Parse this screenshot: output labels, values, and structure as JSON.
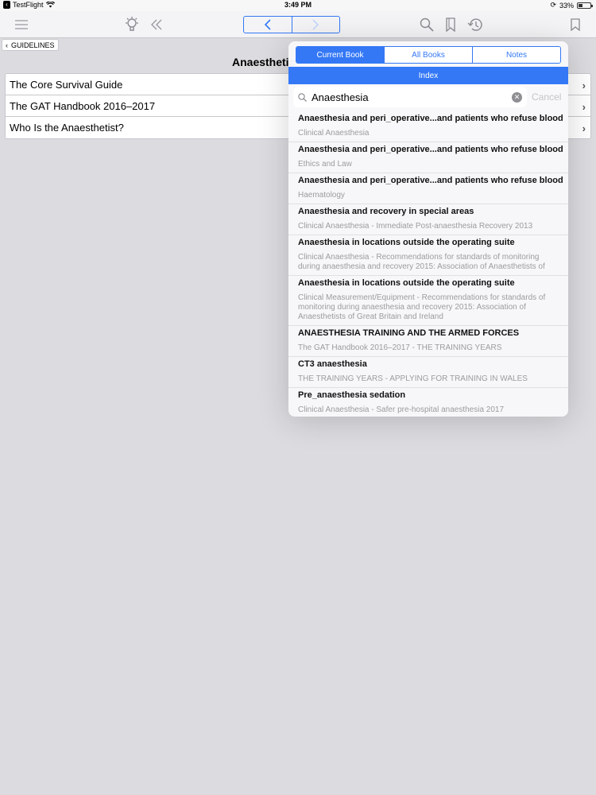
{
  "status_bar": {
    "app_back": "TestFlight",
    "time": "3:49 PM",
    "battery": "33%",
    "battery_level": 0.33
  },
  "toolbar": {
    "icons": [
      "menu-icon",
      "lightbulb-icon",
      "double-chevron-left-icon",
      "back-icon",
      "forward-icon",
      "search-icon",
      "bookmarks-icon",
      "history-icon",
      "bookmark-icon"
    ]
  },
  "breadcrumb": {
    "label": "GUIDELINES"
  },
  "page": {
    "title": "Anaesthetic",
    "books": [
      {
        "label": "The Core Survival Guide"
      },
      {
        "label": "The GAT Handbook 2016–2017"
      },
      {
        "label": "Who Is the Anaesthetist?"
      }
    ]
  },
  "popover": {
    "tabs": [
      {
        "label": "Current Book",
        "active": true
      },
      {
        "label": "All Books",
        "active": false
      },
      {
        "label": "Notes",
        "active": false
      }
    ],
    "index_label": "Index",
    "search": {
      "value": "Anaesthesia",
      "cancel_label": "Cancel"
    },
    "results": [
      {
        "title": "Anaesthesia and peri_operative...and patients who refuse blood",
        "subtitle": "Clinical Anaesthesia"
      },
      {
        "title": "Anaesthesia and peri_operative...and patients who refuse blood",
        "subtitle": "Ethics and Law"
      },
      {
        "title": "Anaesthesia and peri_operative...and patients who refuse blood",
        "subtitle": "Haematology"
      },
      {
        "title": "Anaesthesia and recovery in special areas",
        "subtitle": "Clinical Anaesthesia - Immediate Post-anaesthesia Recovery 2013"
      },
      {
        "title": "Anaesthesia in locations outside the operating suite",
        "subtitle": "Clinical Anaesthesia - Recommendations for standards of monitoring during anaesthesia and recovery 2015: Association of Anaesthetists of"
      },
      {
        "title": "Anaesthesia in locations outside the operating suite",
        "subtitle": "Clinical Measurement/Equipment - Recommendations for standards of monitoring during anaesthesia and recovery 2015: Association of Anaesthetists of Great Britain and Ireland"
      },
      {
        "title": "ANAESTHESIA TRAINING AND THE ARMED FORCES",
        "subtitle": "The GAT Handbook 2016–2017 - THE TRAINING YEARS"
      },
      {
        "title": "CT3 anaesthesia",
        "subtitle": "THE TRAINING YEARS - APPLYING FOR TRAINING IN WALES"
      },
      {
        "title": "Pre_anaesthesia sedation",
        "subtitle": "Clinical Anaesthesia - Safer pre-hospital anaesthesia 2017"
      }
    ]
  },
  "colors": {
    "accent": "#3478f6",
    "background": "#dcdce0"
  }
}
